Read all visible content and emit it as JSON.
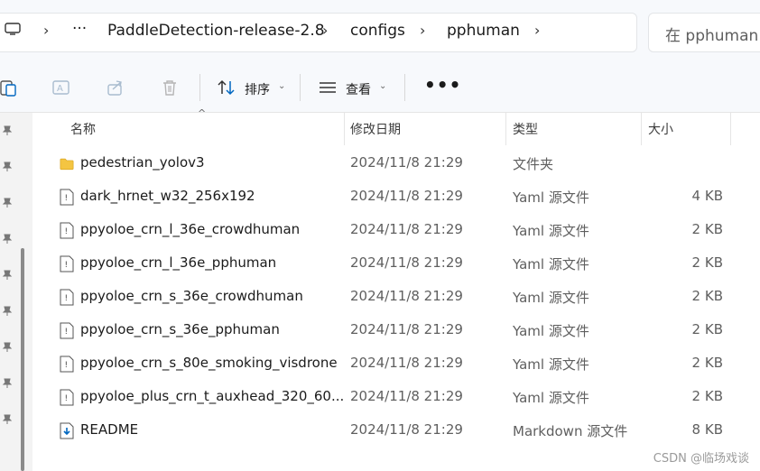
{
  "breadcrumb": {
    "overflow": "···",
    "items": [
      "PaddleDetection-release-2.8",
      "configs",
      "pphuman"
    ]
  },
  "search": {
    "placeholder": "在 pphuman 中"
  },
  "toolbar": {
    "sort_label": "排序",
    "view_label": "查看",
    "more_label": "•••"
  },
  "columns": {
    "name": "名称",
    "date": "修改日期",
    "type": "类型",
    "size": "大小"
  },
  "files": [
    {
      "name": "pedestrian_yolov3",
      "date": "2024/11/8 21:29",
      "type": "文件夹",
      "size": "",
      "icon": "folder-icon"
    },
    {
      "name": "dark_hrnet_w32_256x192",
      "date": "2024/11/8 21:29",
      "type": "Yaml 源文件",
      "size": "4 KB",
      "icon": "yaml-file-icon"
    },
    {
      "name": "ppyoloe_crn_l_36e_crowdhuman",
      "date": "2024/11/8 21:29",
      "type": "Yaml 源文件",
      "size": "2 KB",
      "icon": "yaml-file-icon"
    },
    {
      "name": "ppyoloe_crn_l_36e_pphuman",
      "date": "2024/11/8 21:29",
      "type": "Yaml 源文件",
      "size": "2 KB",
      "icon": "yaml-file-icon"
    },
    {
      "name": "ppyoloe_crn_s_36e_crowdhuman",
      "date": "2024/11/8 21:29",
      "type": "Yaml 源文件",
      "size": "2 KB",
      "icon": "yaml-file-icon"
    },
    {
      "name": "ppyoloe_crn_s_36e_pphuman",
      "date": "2024/11/8 21:29",
      "type": "Yaml 源文件",
      "size": "2 KB",
      "icon": "yaml-file-icon"
    },
    {
      "name": "ppyoloe_crn_s_80e_smoking_visdrone",
      "date": "2024/11/8 21:29",
      "type": "Yaml 源文件",
      "size": "2 KB",
      "icon": "yaml-file-icon"
    },
    {
      "name": "ppyoloe_plus_crn_t_auxhead_320_60...",
      "date": "2024/11/8 21:29",
      "type": "Yaml 源文件",
      "size": "2 KB",
      "icon": "yaml-file-icon"
    },
    {
      "name": "README",
      "date": "2024/11/8 21:29",
      "type": "Markdown 源文件",
      "size": "8 KB",
      "icon": "markdown-file-icon"
    }
  ],
  "watermark": "CSDN @临场戏谈",
  "colors": {
    "folder": "#f4c542",
    "accent": "#0067c0"
  }
}
